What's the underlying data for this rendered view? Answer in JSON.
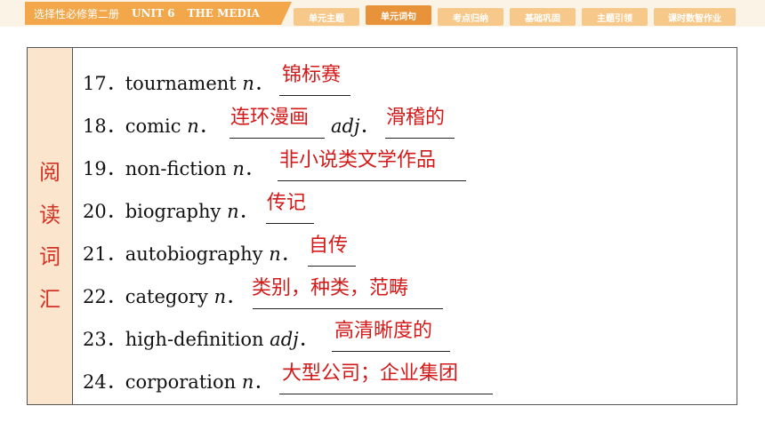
{
  "header": {
    "book_title": "选择性必修第二册",
    "unit": "UNIT 6",
    "theme": "THE MEDIA",
    "tabs": [
      "单元主题",
      "单元词句",
      "考点归纳",
      "基础巩固",
      "主题引领",
      "课时数智作业"
    ],
    "active_tab": "单元词句"
  },
  "side_label": [
    "阅",
    "读",
    "词",
    "汇"
  ],
  "entries": [
    {
      "num": "17．",
      "word": "tournament",
      "pos1": "n",
      "answer1": "锦标赛"
    },
    {
      "num": "18．",
      "word": "comic",
      "pos1": "n",
      "answer1": "连环漫画",
      "pos2": "adj",
      "answer2": "滑稽的"
    },
    {
      "num": "19．",
      "word": "non-fiction",
      "pos1": "n",
      "answer1": "非小说类文学作品"
    },
    {
      "num": "20．",
      "word": "biography",
      "pos1": "n",
      "answer1": "传记"
    },
    {
      "num": "21．",
      "word": "autobiography",
      "pos1": "n",
      "answer1": "自传"
    },
    {
      "num": "22．",
      "word": "category",
      "pos1": "n",
      "answer1": "类别，种类，范畴"
    },
    {
      "num": "23．",
      "word": "high-definition",
      "pos1": "adj",
      "answer1": "高清晰度的"
    },
    {
      "num": "24．",
      "word": "corporation",
      "pos1": "n",
      "answer1": "大型公司；企业集团"
    }
  ],
  "colors": {
    "accent": "#f2a74a",
    "active_tab": "#e8923a",
    "side_bg": "#fbe5cc",
    "answer": "#d31a1a"
  }
}
